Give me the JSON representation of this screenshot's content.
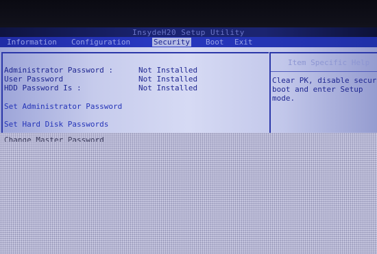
{
  "bios": {
    "title": "InsydeH20 Setup Utility",
    "tabs": [
      {
        "label": "Information"
      },
      {
        "label": "Configuration"
      },
      {
        "label": "Security"
      },
      {
        "label": "Boot"
      },
      {
        "label": "Exit"
      }
    ],
    "active_tab": "Security",
    "settings": [
      {
        "label": "Administrator Password :",
        "value": "Not Installed"
      },
      {
        "label": "User Password",
        "value": "Not Installed"
      },
      {
        "label": "HDD Password Is :",
        "value": "Not Installed"
      }
    ],
    "actions": [
      {
        "label": "Set Administrator Password"
      },
      {
        "label": "Set Hard Disk Passwords"
      },
      {
        "label": "Change Master Password"
      }
    ],
    "help": {
      "title": "Item Specific Help",
      "lines": [
        "Clear PK, disable secure",
        "boot and enter Setup",
        "mode."
      ]
    },
    "colors": {
      "menu_bar": "#2838c0",
      "panel": "#d6daf4",
      "text": "#1e2690",
      "highlight": "#2434b8"
    }
  }
}
